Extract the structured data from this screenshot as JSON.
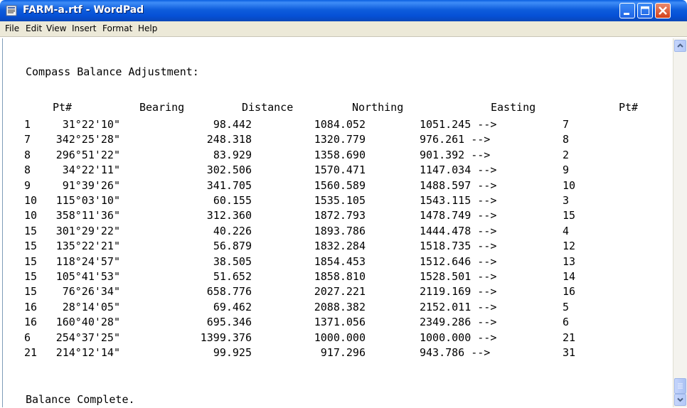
{
  "window": {
    "title": "FARM-a.rtf - WordPad"
  },
  "menu": [
    "File",
    "Edit",
    "View",
    "Insert",
    "Format",
    "Help"
  ],
  "document": {
    "heading": "Compass Balance Adjustment:",
    "columns": [
      "Pt#",
      "Bearing",
      "Distance",
      "Northing",
      "Easting",
      "Pt#"
    ],
    "rows": [
      [
        "1",
        "31°22'10\"",
        "98.442",
        "1084.052",
        "1051.245 -->",
        "7"
      ],
      [
        "7",
        "342°25'28\"",
        "248.318",
        "1320.779",
        "976.261 -->",
        "8"
      ],
      [
        "8",
        "296°51'22\"",
        "83.929",
        "1358.690",
        "901.392 -->",
        "2"
      ],
      [
        "8",
        "34°22'11\"",
        "302.506",
        "1570.471",
        "1147.034 -->",
        "9"
      ],
      [
        "9",
        "91°39'26\"",
        "341.705",
        "1560.589",
        "1488.597 -->",
        "10"
      ],
      [
        "10",
        "115°03'10\"",
        "60.155",
        "1535.105",
        "1543.115 -->",
        "3"
      ],
      [
        "10",
        "358°11'36\"",
        "312.360",
        "1872.793",
        "1478.749 -->",
        "15"
      ],
      [
        "15",
        "301°29'22\"",
        "40.226",
        "1893.786",
        "1444.478 -->",
        "4"
      ],
      [
        "15",
        "135°22'21\"",
        "56.879",
        "1832.284",
        "1518.735 -->",
        "12"
      ],
      [
        "15",
        "118°24'57\"",
        "38.505",
        "1854.453",
        "1512.646 -->",
        "13"
      ],
      [
        "15",
        "105°41'53\"",
        "51.652",
        "1858.810",
        "1528.501 -->",
        "14"
      ],
      [
        "15",
        "76°26'34\"",
        "658.776",
        "2027.221",
        "2119.169 -->",
        "16"
      ],
      [
        "16",
        "28°14'05\"",
        "69.462",
        "2088.382",
        "2152.011 -->",
        "5"
      ],
      [
        "16",
        "160°40'28\"",
        "695.346",
        "1371.056",
        "2349.286 -->",
        "6"
      ],
      [
        "6",
        "254°37'25\"",
        "1399.376",
        "1000.000",
        "1000.000 -->",
        "21"
      ],
      [
        "21",
        "214°12'14\"",
        "99.925",
        "917.296",
        "943.786 -->",
        "31"
      ]
    ],
    "footer": "Balance Complete."
  }
}
